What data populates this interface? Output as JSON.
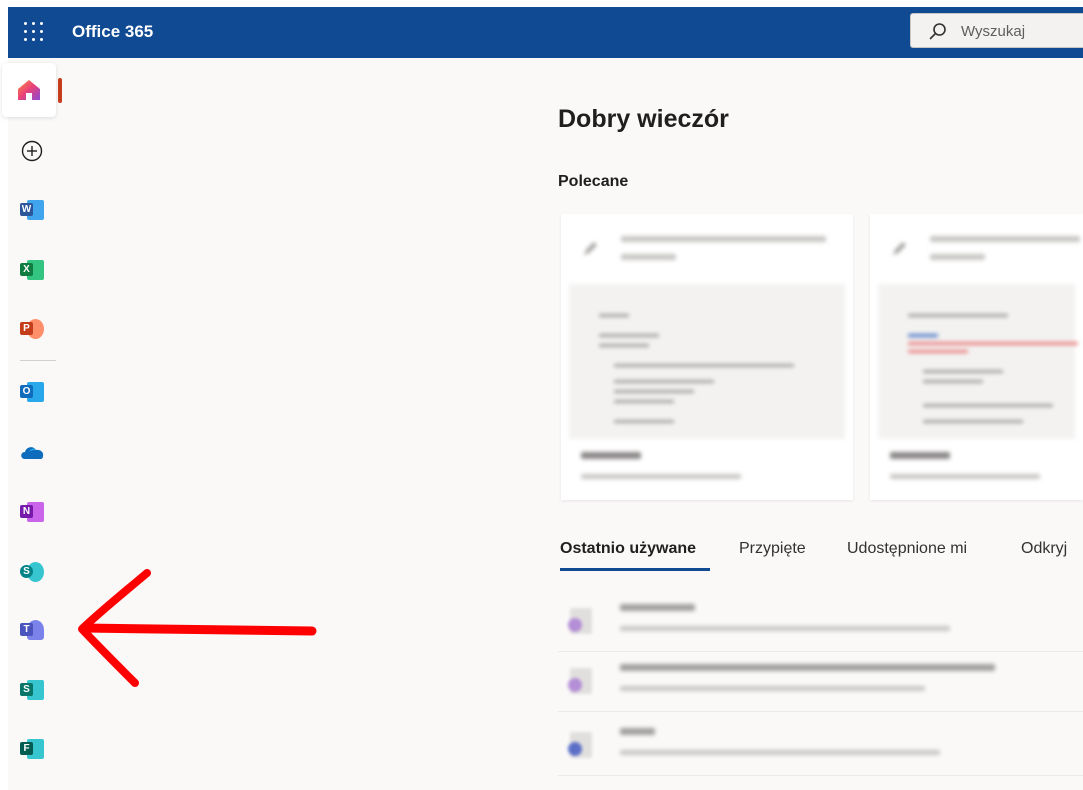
{
  "header": {
    "app_title": "Office 365",
    "search_placeholder": "Wyszukaj",
    "bar_color": "#0f4a93"
  },
  "sidebar": {
    "items": [
      {
        "name": "home",
        "icon": "home-icon",
        "active": true
      },
      {
        "name": "create",
        "icon": "plus-circle-icon"
      },
      {
        "name": "word",
        "icon": "word-icon",
        "letter": "W",
        "color": "#2b579a"
      },
      {
        "name": "excel",
        "icon": "excel-icon",
        "letter": "X",
        "color": "#217346"
      },
      {
        "name": "powerpoint",
        "icon": "powerpoint-icon",
        "letter": "P",
        "color": "#d24726"
      },
      {
        "name": "outlook",
        "icon": "outlook-icon",
        "letter": "O",
        "color": "#0f6cbd"
      },
      {
        "name": "onedrive",
        "icon": "onedrive-icon"
      },
      {
        "name": "onenote",
        "icon": "onenote-icon",
        "letter": "N",
        "color": "#7719aa"
      },
      {
        "name": "sharepoint",
        "icon": "sharepoint-icon",
        "letter": "S",
        "color": "#038387"
      },
      {
        "name": "teams",
        "icon": "teams-icon",
        "letter": "T",
        "color": "#5b5fc7"
      },
      {
        "name": "sway",
        "icon": "sway-icon",
        "letter": "S",
        "color": "#008272"
      },
      {
        "name": "forms",
        "icon": "forms-icon",
        "letter": "F",
        "color": "#077568"
      }
    ]
  },
  "main": {
    "greeting": "Dobry wieczór",
    "recommended_title": "Polecane",
    "tabs": [
      {
        "label": "Ostatnio używane",
        "active": true
      },
      {
        "label": "Przypięte"
      },
      {
        "label": "Udostępnione mi"
      },
      {
        "label": "Odkryj"
      }
    ]
  },
  "annotation": {
    "color": "#ff0000",
    "points_to": "teams-icon"
  }
}
